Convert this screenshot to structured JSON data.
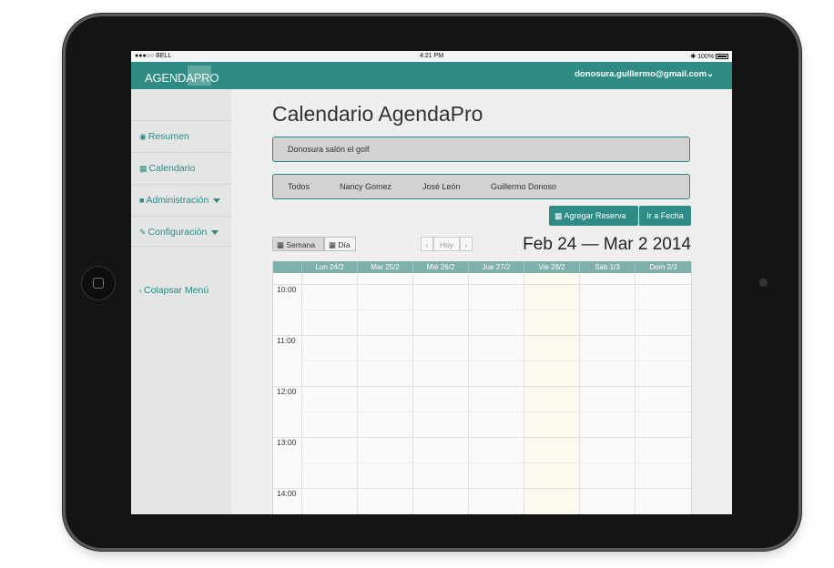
{
  "status_bar": {
    "carrier": "●●●○○ BELL",
    "time": "4:21 PM",
    "battery": "✱ 100%"
  },
  "header": {
    "logo_main": "AGENDA",
    "logo_pro": "PRO",
    "user_email": "donosura.guillermo@gmail.com"
  },
  "sidebar": {
    "items": [
      {
        "icon": "dashboard-icon",
        "label": "Resumen"
      },
      {
        "icon": "calendar-icon",
        "label": "Calendario"
      },
      {
        "icon": "briefcase-icon",
        "label": "Administración"
      },
      {
        "icon": "wrench-icon",
        "label": "Configuración"
      }
    ],
    "collapse": "Colapsar Menú"
  },
  "main": {
    "title": "Calendario AgendaPro",
    "location": "Donosura salón el golf",
    "filters": [
      "Todos",
      "Nancy Gomez",
      "José León",
      "Guillermo Donoso"
    ],
    "add_booking": "Agregar Reserva",
    "goto_date": "Ir a Fecha",
    "view_week": "Semana",
    "view_day": "Día",
    "prev": "‹",
    "today": "Hoy",
    "next": "›",
    "date_range": "Feb 24 — Mar 2 2014",
    "days": [
      "Lun 24/2",
      "Mar 25/2",
      "Mié 26/2",
      "Jue 27/2",
      "Vie 28/2",
      "Sáb 1/3",
      "Dom 2/3"
    ],
    "hours": [
      "10:00",
      "11:00",
      "12:00",
      "13:00",
      "14:00"
    ]
  },
  "colors": {
    "accent": "#2f8c84",
    "header_row": "#7eb1ab",
    "today_column": "#fcfaee"
  }
}
